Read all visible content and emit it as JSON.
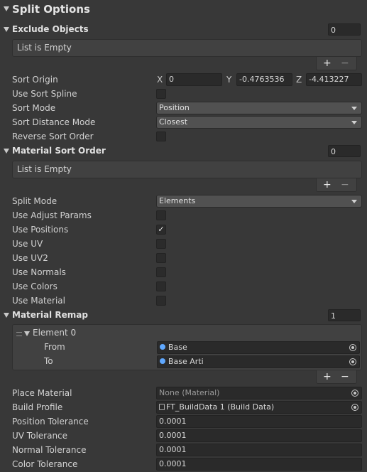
{
  "title": "Split Options",
  "exclude": {
    "label": "Exclude Objects",
    "count": "0",
    "empty": "List is Empty",
    "add": "+",
    "remove": "−"
  },
  "sort_origin": {
    "label": "Sort Origin",
    "x_axis": "X",
    "x": "0",
    "y_axis": "Y",
    "y": "-0.4763536",
    "z_axis": "Z",
    "z": "-4.413227"
  },
  "use_sort_spline": {
    "label": "Use Sort Spline",
    "checked": false
  },
  "sort_mode": {
    "label": "Sort Mode",
    "value": "Position"
  },
  "sort_distance_mode": {
    "label": "Sort Distance Mode",
    "value": "Closest"
  },
  "reverse_sort_order": {
    "label": "Reverse Sort Order",
    "checked": false
  },
  "material_sort_order": {
    "label": "Material Sort Order",
    "count": "0",
    "empty": "List is Empty",
    "add": "+",
    "remove": "−"
  },
  "split_mode": {
    "label": "Split Mode",
    "value": "Elements"
  },
  "flags": {
    "use_adjust_params": {
      "label": "Use Adjust Params",
      "checked": false
    },
    "use_positions": {
      "label": "Use Positions",
      "checked": true,
      "mark": "✓"
    },
    "use_uv": {
      "label": "Use UV",
      "checked": false
    },
    "use_uv2": {
      "label": "Use UV2",
      "checked": false
    },
    "use_normals": {
      "label": "Use Normals",
      "checked": false
    },
    "use_colors": {
      "label": "Use Colors",
      "checked": false
    },
    "use_material": {
      "label": "Use Material",
      "checked": false
    }
  },
  "material_remap": {
    "label": "Material Remap",
    "count": "1",
    "element": {
      "label": "Element 0",
      "from_label": "From",
      "from_value": "Base",
      "to_label": "To",
      "to_value": "Base Arti"
    },
    "add": "+",
    "remove": "−"
  },
  "place_material": {
    "label": "Place Material",
    "value": "None (Material)"
  },
  "build_profile": {
    "label": "Build Profile",
    "value": "FT_BuildData 1 (Build Data)"
  },
  "tolerances": [
    {
      "label": "Position Tolerance",
      "value": "0.0001"
    },
    {
      "label": "UV Tolerance",
      "value": "0.0001"
    },
    {
      "label": "Normal Tolerance",
      "value": "0.0001"
    },
    {
      "label": "Color Tolerance",
      "value": "0.0001"
    }
  ],
  "colors": {
    "background": "#383838",
    "field": "#2a2a2a",
    "dropdown": "#515151",
    "object_dot": "#5fa8ff"
  },
  "icons": [
    "foldout-arrow-icon",
    "object-picker-icon",
    "checkmark-icon",
    "drag-handle-icon",
    "build-data-icon"
  ]
}
